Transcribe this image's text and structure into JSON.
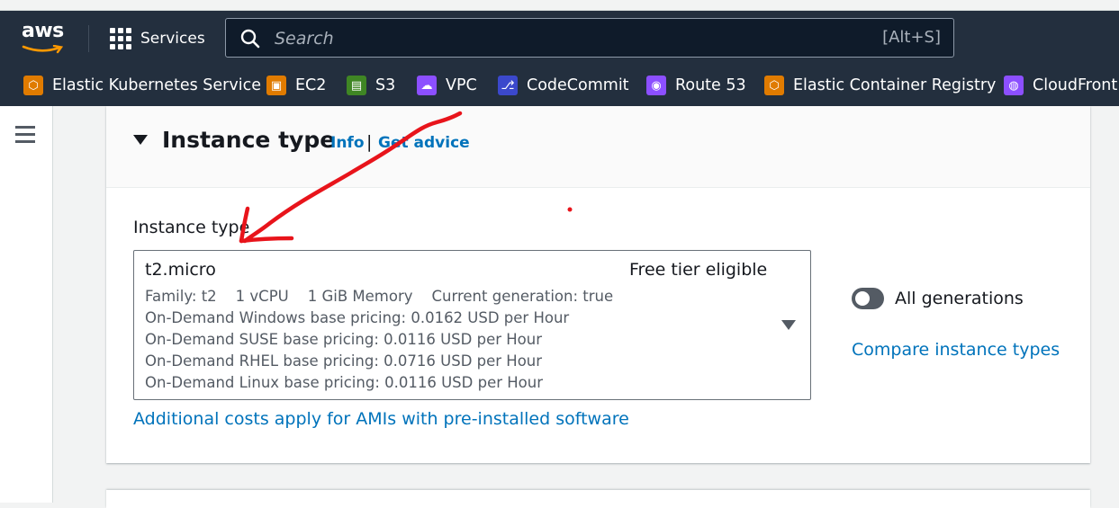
{
  "nav": {
    "logo_text": "aws",
    "services_label": "Services",
    "search_placeholder": "Search",
    "search_shortcut": "[Alt+S]",
    "favorites": [
      {
        "label": "Elastic Kubernetes Service",
        "icon": "eks-icon",
        "color": "#e07b00"
      },
      {
        "label": "EC2",
        "icon": "ec2-icon",
        "color": "#e07b00"
      },
      {
        "label": "S3",
        "icon": "s3-icon",
        "color": "#3f8624"
      },
      {
        "label": "VPC",
        "icon": "vpc-icon",
        "color": "#8c4fff"
      },
      {
        "label": "CodeCommit",
        "icon": "codecommit-icon",
        "color": "#3b48cc"
      },
      {
        "label": "Route 53",
        "icon": "route53-icon",
        "color": "#8c4fff"
      },
      {
        "label": "Elastic Container Registry",
        "icon": "ecr-icon",
        "color": "#e07b00"
      },
      {
        "label": "CloudFront",
        "icon": "cloudfront-icon",
        "color": "#8c4fff"
      }
    ]
  },
  "section": {
    "title": "Instance type",
    "info_link": "Info",
    "separator": "|",
    "advice_link": "Get advice"
  },
  "instance": {
    "field_label": "Instance type",
    "selected": {
      "name": "t2.micro",
      "tier": "Free tier eligible",
      "family": "Family: t2",
      "vcpu": "1 vCPU",
      "memory": "1 GiB Memory",
      "generation": "Current generation: true",
      "pricing": [
        "On-Demand Windows base pricing: 0.0162 USD per Hour",
        "On-Demand SUSE base pricing: 0.0116 USD per Hour",
        "On-Demand RHEL base pricing: 0.0716 USD per Hour",
        "On-Demand Linux base pricing: 0.0116 USD per Hour"
      ]
    },
    "all_generations_label": "All generations",
    "all_generations_on": false,
    "compare_link": "Compare instance types",
    "costs_link": "Additional costs apply for AMIs with pre-installed software"
  },
  "colors": {
    "nav_bg": "#232f3e",
    "link": "#0073bb",
    "annotation": "#e8141b"
  }
}
